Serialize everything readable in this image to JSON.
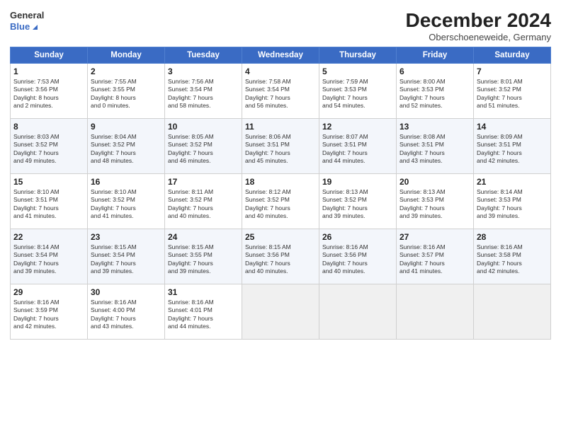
{
  "logo": {
    "line1": "General",
    "line2": "Blue"
  },
  "title": "December 2024",
  "subtitle": "Oberschoeneweide, Germany",
  "weekdays": [
    "Sunday",
    "Monday",
    "Tuesday",
    "Wednesday",
    "Thursday",
    "Friday",
    "Saturday"
  ],
  "weeks": [
    [
      {
        "day": "1",
        "lines": [
          "Sunrise: 7:53 AM",
          "Sunset: 3:56 PM",
          "Daylight: 8 hours",
          "and 2 minutes."
        ]
      },
      {
        "day": "2",
        "lines": [
          "Sunrise: 7:55 AM",
          "Sunset: 3:55 PM",
          "Daylight: 8 hours",
          "and 0 minutes."
        ]
      },
      {
        "day": "3",
        "lines": [
          "Sunrise: 7:56 AM",
          "Sunset: 3:54 PM",
          "Daylight: 7 hours",
          "and 58 minutes."
        ]
      },
      {
        "day": "4",
        "lines": [
          "Sunrise: 7:58 AM",
          "Sunset: 3:54 PM",
          "Daylight: 7 hours",
          "and 56 minutes."
        ]
      },
      {
        "day": "5",
        "lines": [
          "Sunrise: 7:59 AM",
          "Sunset: 3:53 PM",
          "Daylight: 7 hours",
          "and 54 minutes."
        ]
      },
      {
        "day": "6",
        "lines": [
          "Sunrise: 8:00 AM",
          "Sunset: 3:53 PM",
          "Daylight: 7 hours",
          "and 52 minutes."
        ]
      },
      {
        "day": "7",
        "lines": [
          "Sunrise: 8:01 AM",
          "Sunset: 3:52 PM",
          "Daylight: 7 hours",
          "and 51 minutes."
        ]
      }
    ],
    [
      {
        "day": "8",
        "lines": [
          "Sunrise: 8:03 AM",
          "Sunset: 3:52 PM",
          "Daylight: 7 hours",
          "and 49 minutes."
        ]
      },
      {
        "day": "9",
        "lines": [
          "Sunrise: 8:04 AM",
          "Sunset: 3:52 PM",
          "Daylight: 7 hours",
          "and 48 minutes."
        ]
      },
      {
        "day": "10",
        "lines": [
          "Sunrise: 8:05 AM",
          "Sunset: 3:52 PM",
          "Daylight: 7 hours",
          "and 46 minutes."
        ]
      },
      {
        "day": "11",
        "lines": [
          "Sunrise: 8:06 AM",
          "Sunset: 3:51 PM",
          "Daylight: 7 hours",
          "and 45 minutes."
        ]
      },
      {
        "day": "12",
        "lines": [
          "Sunrise: 8:07 AM",
          "Sunset: 3:51 PM",
          "Daylight: 7 hours",
          "and 44 minutes."
        ]
      },
      {
        "day": "13",
        "lines": [
          "Sunrise: 8:08 AM",
          "Sunset: 3:51 PM",
          "Daylight: 7 hours",
          "and 43 minutes."
        ]
      },
      {
        "day": "14",
        "lines": [
          "Sunrise: 8:09 AM",
          "Sunset: 3:51 PM",
          "Daylight: 7 hours",
          "and 42 minutes."
        ]
      }
    ],
    [
      {
        "day": "15",
        "lines": [
          "Sunrise: 8:10 AM",
          "Sunset: 3:51 PM",
          "Daylight: 7 hours",
          "and 41 minutes."
        ]
      },
      {
        "day": "16",
        "lines": [
          "Sunrise: 8:10 AM",
          "Sunset: 3:52 PM",
          "Daylight: 7 hours",
          "and 41 minutes."
        ]
      },
      {
        "day": "17",
        "lines": [
          "Sunrise: 8:11 AM",
          "Sunset: 3:52 PM",
          "Daylight: 7 hours",
          "and 40 minutes."
        ]
      },
      {
        "day": "18",
        "lines": [
          "Sunrise: 8:12 AM",
          "Sunset: 3:52 PM",
          "Daylight: 7 hours",
          "and 40 minutes."
        ]
      },
      {
        "day": "19",
        "lines": [
          "Sunrise: 8:13 AM",
          "Sunset: 3:52 PM",
          "Daylight: 7 hours",
          "and 39 minutes."
        ]
      },
      {
        "day": "20",
        "lines": [
          "Sunrise: 8:13 AM",
          "Sunset: 3:53 PM",
          "Daylight: 7 hours",
          "and 39 minutes."
        ]
      },
      {
        "day": "21",
        "lines": [
          "Sunrise: 8:14 AM",
          "Sunset: 3:53 PM",
          "Daylight: 7 hours",
          "and 39 minutes."
        ]
      }
    ],
    [
      {
        "day": "22",
        "lines": [
          "Sunrise: 8:14 AM",
          "Sunset: 3:54 PM",
          "Daylight: 7 hours",
          "and 39 minutes."
        ]
      },
      {
        "day": "23",
        "lines": [
          "Sunrise: 8:15 AM",
          "Sunset: 3:54 PM",
          "Daylight: 7 hours",
          "and 39 minutes."
        ]
      },
      {
        "day": "24",
        "lines": [
          "Sunrise: 8:15 AM",
          "Sunset: 3:55 PM",
          "Daylight: 7 hours",
          "and 39 minutes."
        ]
      },
      {
        "day": "25",
        "lines": [
          "Sunrise: 8:15 AM",
          "Sunset: 3:56 PM",
          "Daylight: 7 hours",
          "and 40 minutes."
        ]
      },
      {
        "day": "26",
        "lines": [
          "Sunrise: 8:16 AM",
          "Sunset: 3:56 PM",
          "Daylight: 7 hours",
          "and 40 minutes."
        ]
      },
      {
        "day": "27",
        "lines": [
          "Sunrise: 8:16 AM",
          "Sunset: 3:57 PM",
          "Daylight: 7 hours",
          "and 41 minutes."
        ]
      },
      {
        "day": "28",
        "lines": [
          "Sunrise: 8:16 AM",
          "Sunset: 3:58 PM",
          "Daylight: 7 hours",
          "and 42 minutes."
        ]
      }
    ],
    [
      {
        "day": "29",
        "lines": [
          "Sunrise: 8:16 AM",
          "Sunset: 3:59 PM",
          "Daylight: 7 hours",
          "and 42 minutes."
        ]
      },
      {
        "day": "30",
        "lines": [
          "Sunrise: 8:16 AM",
          "Sunset: 4:00 PM",
          "Daylight: 7 hours",
          "and 43 minutes."
        ]
      },
      {
        "day": "31",
        "lines": [
          "Sunrise: 8:16 AM",
          "Sunset: 4:01 PM",
          "Daylight: 7 hours",
          "and 44 minutes."
        ]
      },
      {
        "day": "",
        "lines": [],
        "empty": true
      },
      {
        "day": "",
        "lines": [],
        "empty": true
      },
      {
        "day": "",
        "lines": [],
        "empty": true
      },
      {
        "day": "",
        "lines": [],
        "empty": true
      }
    ]
  ]
}
